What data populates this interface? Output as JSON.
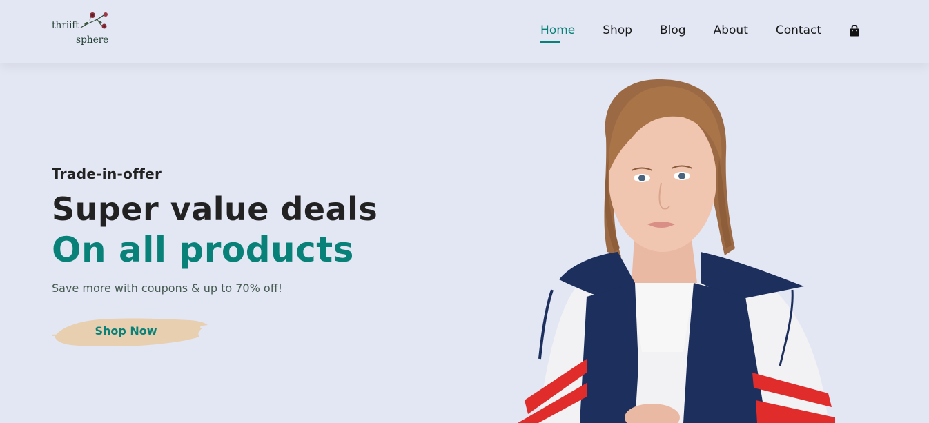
{
  "logo": {
    "line1": "thriift",
    "line2": "sphere"
  },
  "nav": {
    "items": [
      {
        "label": "Home",
        "active": true
      },
      {
        "label": "Shop",
        "active": false
      },
      {
        "label": "Blog",
        "active": false
      },
      {
        "label": "About",
        "active": false
      },
      {
        "label": "Contact",
        "active": false
      }
    ],
    "cart_icon": "shopping-bag-icon"
  },
  "hero": {
    "kicker": "Trade-in-offer",
    "headline": "Super value deals",
    "subheadline": "On all products",
    "description": "Save more with coupons & up to 70% off!",
    "cta_label": "Shop Now"
  },
  "colors": {
    "background": "#e3e6f3",
    "accent": "#088178",
    "text": "#222222",
    "button_brush": "#e8cfb0"
  }
}
